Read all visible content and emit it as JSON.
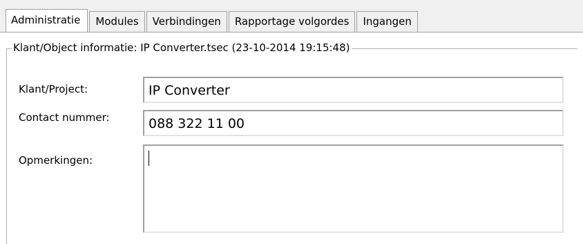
{
  "tabs": [
    {
      "label": "Administratie",
      "active": true
    },
    {
      "label": "Modules",
      "active": false
    },
    {
      "label": "Verbindingen",
      "active": false
    },
    {
      "label": "Rapportage volgordes",
      "active": false
    },
    {
      "label": "Ingangen",
      "active": false
    }
  ],
  "group": {
    "title": "Klant/Object informatie: IP Converter.tsec (23-10-2014 19:15:48)"
  },
  "form": {
    "customer_label": "Klant/Project:",
    "customer_value": "IP Converter",
    "contact_label": "Contact nummer:",
    "contact_value": "088 322 11 00",
    "remarks_label": "Opmerkingen:",
    "remarks_value": ""
  }
}
